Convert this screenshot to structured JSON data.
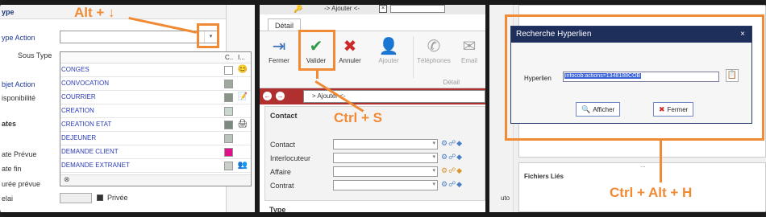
{
  "panel1": {
    "header_label": "ype",
    "type_action_label": "ype Action",
    "sous_type_label": "Sous Type",
    "objet_action_label": "bjet Action",
    "disponibilite_label": "isponibilité",
    "dates_section": "ates",
    "date_prevue_label": "ate Prévue",
    "date_fin_label": "ate fin",
    "duree_prevue_label": "urée prévue",
    "delai_label": "elai",
    "privee_label": "Privée",
    "dropdown": {
      "col_c": "C..",
      "col_i": "I...",
      "items": [
        {
          "label": "CONGES",
          "color": "#ffffff",
          "icon": "😊"
        },
        {
          "label": "CONVOCATION",
          "color": "#a0a8a0",
          "icon": ""
        },
        {
          "label": "COURRIER",
          "color": "#8a9488",
          "icon": "📝"
        },
        {
          "label": "CREATION",
          "color": "#c8d8cc",
          "icon": ""
        },
        {
          "label": "CREATION ETAT",
          "color": "#7a8a80",
          "icon": "🖨"
        },
        {
          "label": "DEJEUNER",
          "color": "#b8c4bc",
          "icon": ""
        },
        {
          "label": "DEMANDE CLIENT",
          "color": "#e0108a",
          "icon": ""
        },
        {
          "label": "DEMANDE EXTRANET",
          "color": "#c8d0c8",
          "icon": "👥"
        }
      ],
      "footer_icon": "⊗"
    }
  },
  "panel2": {
    "top_tab": "-> Ajouter <-",
    "detail_tab": "Détail",
    "ribbon": {
      "fermer": "Fermer",
      "valider": "Valider",
      "annuler": "Annuler",
      "ajouter": "Ajouter",
      "telephones": "Téléphones",
      "email": "Email",
      "group_label": "Détail"
    },
    "nav_field": "> Ajouter <-",
    "contact_section": "Contact",
    "fields": {
      "contact": "Contact",
      "interlocuteur": "Interlocuteur",
      "affaire": "Affaire",
      "contrat": "Contrat"
    },
    "type_section": "Type"
  },
  "panel3": {
    "dialog_title": "Recherche Hyperlien",
    "close": "×",
    "hyperlien_label": "Hyperlien",
    "hyperlien_value": "infocob:actions=1348188COB",
    "afficher": "Afficher",
    "fermer": "Fermer",
    "fichiers_lies": "Fichiers Liés",
    "dots": "...",
    "side_text": "uto"
  },
  "annotations": {
    "alt_down": "Alt + ↓",
    "ctrl_s": "Ctrl + S",
    "ctrl_alt_h": "Ctrl + Alt + H",
    "color": "#f08a34"
  }
}
